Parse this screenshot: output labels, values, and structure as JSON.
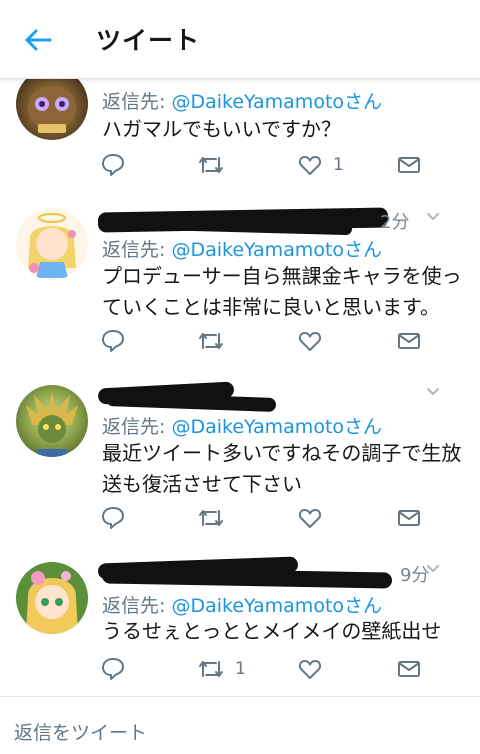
{
  "header": {
    "title": "ツイート"
  },
  "tweets": [
    {
      "reply_prefix": "返信先: ",
      "reply_handle": "@DaikeYamamotoさん",
      "lines": [
        "ハガマルでもいいですか？"
      ],
      "time": "",
      "like_count": "1",
      "retweet_count": ""
    },
    {
      "reply_prefix": "返信先: ",
      "reply_handle": "@DaikeYamamotoさん",
      "lines": [
        "プロデューサー自ら無課金キャラを使っ",
        "ていくことは非常に良いと思います。"
      ],
      "time": "2分",
      "like_count": "",
      "retweet_count": ""
    },
    {
      "reply_prefix": "返信先: ",
      "reply_handle": "@DaikeYamamotoさん",
      "lines": [
        "最近ツイート多いですねその調子で生放",
        "送も復活させて下さい"
      ],
      "time": "",
      "like_count": "",
      "retweet_count": ""
    },
    {
      "reply_prefix": "返信先: ",
      "reply_handle": "@DaikeYamamotoさん",
      "lines": [
        "うるせぇとっととメイメイの壁紙出せ"
      ],
      "time": "9分",
      "like_count": "",
      "retweet_count": "1"
    }
  ],
  "compose": {
    "placeholder": "返信をツイート"
  },
  "colors": {
    "accent": "#1da1f2",
    "muted": "#657786",
    "link": "#1b95e0"
  },
  "icons": [
    "back-arrow-icon",
    "reply-icon",
    "retweet-icon",
    "like-icon",
    "message-icon",
    "chevron-down-icon"
  ]
}
